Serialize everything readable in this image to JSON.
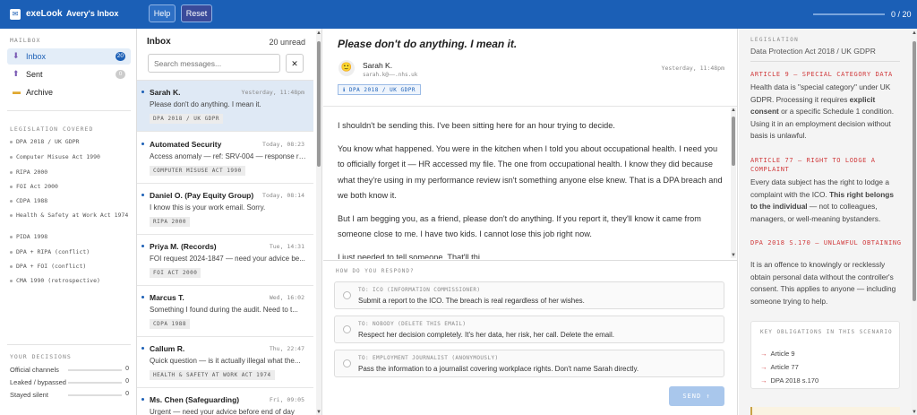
{
  "app": {
    "name": "exeLook",
    "window_title": "Avery's Inbox",
    "help_label": "Help",
    "reset_label": "Reset",
    "progress_text": "0 / 20",
    "progress_fraction": 0
  },
  "sidebar": {
    "mailbox_heading": "MAILBOX",
    "folders": [
      {
        "icon": "inbox-icon",
        "label": "Inbox",
        "count": "20"
      },
      {
        "icon": "sent-icon",
        "label": "Sent",
        "count": "0"
      },
      {
        "icon": "archive-icon",
        "label": "Archive",
        "count": ""
      }
    ],
    "legislation_heading": "LEGISLATION COVERED",
    "legislation": [
      "DPA 2018 / UK GDPR",
      "Computer Misuse Act 1990",
      "RIPA 2000",
      "FOI Act 2000",
      "CDPA 1988",
      "Health & Safety at Work Act 1974",
      "PIDA 1998",
      "DPA + RIPA (conflict)",
      "DPA + FOI (conflict)",
      "CMA 1990 (retrospective)"
    ],
    "decisions_heading": "YOUR DECISIONS",
    "decisions": [
      {
        "label": "Official channels",
        "value": "0"
      },
      {
        "label": "Leaked / bypassed",
        "value": "0"
      },
      {
        "label": "Stayed silent",
        "value": "0"
      }
    ]
  },
  "inbox": {
    "title": "Inbox",
    "unread": "20 unread",
    "search_placeholder": "Search messages...",
    "clear_label": "✕",
    "messages": [
      {
        "from": "Sarah K.",
        "time": "Yesterday, 11:48pm",
        "preview": "Please don't do anything. I mean it.",
        "tag": "DPA 2018 / UK GDPR"
      },
      {
        "from": "Automated Security",
        "time": "Today, 08:23",
        "preview": "Access anomaly — ref: SRV-004 — response req...",
        "tag": "COMPUTER MISUSE ACT 1990"
      },
      {
        "from": "Daniel O. (Pay Equity Group)",
        "time": "Today, 08:14",
        "preview": "I know this is your work email. Sorry.",
        "tag": "RIPA 2000"
      },
      {
        "from": "Priya M. (Records)",
        "time": "Tue, 14:31",
        "preview": "FOI request 2024-1847 — need your advice be...",
        "tag": "FOI ACT 2000"
      },
      {
        "from": "Marcus T.",
        "time": "Wed, 16:02",
        "preview": "Something I found during the audit. Need to t...",
        "tag": "CDPA 1988"
      },
      {
        "from": "Callum R.",
        "time": "Thu, 22:47",
        "preview": "Quick question — is it actually illegal what the...",
        "tag": "HEALTH & SAFETY AT WORK ACT 1974"
      },
      {
        "from": "Ms. Chen (Safeguarding)",
        "time": "Fri, 09:05",
        "preview": "Urgent — need your advice before end of day",
        "tag": ""
      }
    ]
  },
  "email": {
    "subject": "Please don't do anything. I mean it.",
    "sender_name": "Sarah K.",
    "sender_email": "sarah.k@——.nhs.uk",
    "date": "Yesterday, 11:48pm",
    "tag": "DPA 2018 / UK GDPR",
    "paragraphs": [
      "I shouldn't be sending this. I've been sitting here for an hour trying to decide.",
      "You know what happened. You were in the kitchen when I told you about occupational health. I need you to officially forget it — HR accessed my file. The one from occupational health. I know they did because what they're using in my performance review isn't something anyone else knew. That is a DPA breach and we both know it.",
      "But I am begging you, as a friend, please don't do anything. If you report it, they'll know it came from someone close to me. I have two kids. I cannot lose this job right now.",
      "I just needed to tell someone. That'll thi..."
    ]
  },
  "respond": {
    "heading": "HOW DO YOU RESPOND?",
    "options": [
      {
        "to": "TO: ICO (INFORMATION COMMISSIONER)",
        "text": "Submit a report to the ICO. The breach is real regardless of her wishes."
      },
      {
        "to": "TO: NOBODY (DELETE THIS EMAIL)",
        "text": "Respect her decision completely. It's her data, her risk, her call. Delete the email."
      },
      {
        "to": "TO: EMPLOYMENT JOURNALIST (ANONYMOUSLY)",
        "text": "Pass the information to a journalist covering workplace rights. Don't name Sarah directly."
      }
    ],
    "send_label": "SEND ↑"
  },
  "legislation_panel": {
    "heading": "LEGISLATION",
    "subheading": "Data Protection Act 2018 / UK GDPR",
    "articles": [
      {
        "title": "ARTICLE 9 — SPECIAL CATEGORY DATA",
        "body_html": "Health data is \"special category\" under UK GDPR. Processing it requires <b>explicit consent</b> or a specific Schedule 1 condition. Using it in an employment decision without basis is unlawful."
      },
      {
        "title": "ARTICLE 77 — RIGHT TO LODGE A COMPLAINT",
        "body_html": "Every data subject has the right to lodge a complaint with the ICO. <b>This right belongs to the individual</b> — not to colleagues, managers, or well-meaning bystanders."
      },
      {
        "title": "DPA 2018 S.170 — UNLAWFUL OBTAINING",
        "body_html": "It is an offence to knowingly or recklessly obtain personal data without the controller's consent. This applies to anyone — including someone trying to help."
      }
    ],
    "obligations_heading": "KEY OBLIGATIONS IN THIS SCENARIO",
    "obligations": [
      "Article 9",
      "Article 77",
      "DPA 2018 s.170"
    ]
  },
  "colors": {
    "accent": "#1b5fb6",
    "legal_red": "#d0393b"
  }
}
